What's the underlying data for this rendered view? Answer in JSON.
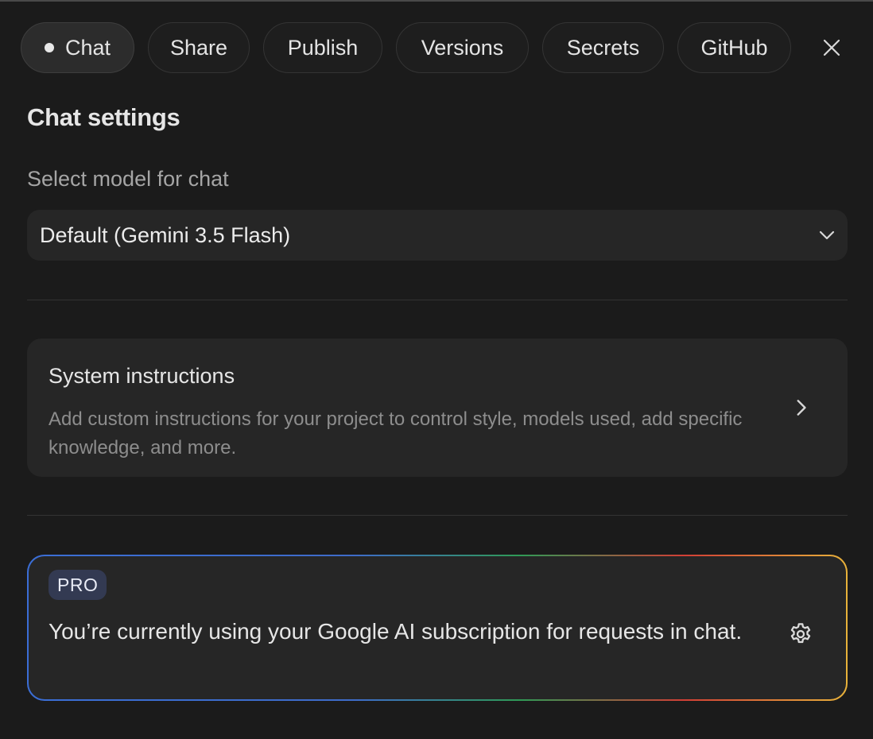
{
  "tabs": [
    {
      "label": "Chat",
      "active": true
    },
    {
      "label": "Share"
    },
    {
      "label": "Publish"
    },
    {
      "label": "Versions"
    },
    {
      "label": "Secrets"
    },
    {
      "label": "GitHub"
    }
  ],
  "header": {
    "close_icon": "close-icon"
  },
  "settings": {
    "title": "Chat settings",
    "model_label": "Select model for chat",
    "model_value": "Default (Gemini 3.5 Flash)"
  },
  "system_instructions": {
    "title": "System instructions",
    "description": "Add custom instructions for your project to control style, models used, add specific knowledge, and more."
  },
  "pro": {
    "badge": "PRO",
    "message": "You’re currently using your Google AI subscription for requests in chat."
  },
  "colors": {
    "background": "#1b1b1b",
    "card": "#262626",
    "badge": "#333a52",
    "gradient": [
      "#3b6ed6",
      "#2f9a56",
      "#d23f36",
      "#e8b23a"
    ]
  }
}
